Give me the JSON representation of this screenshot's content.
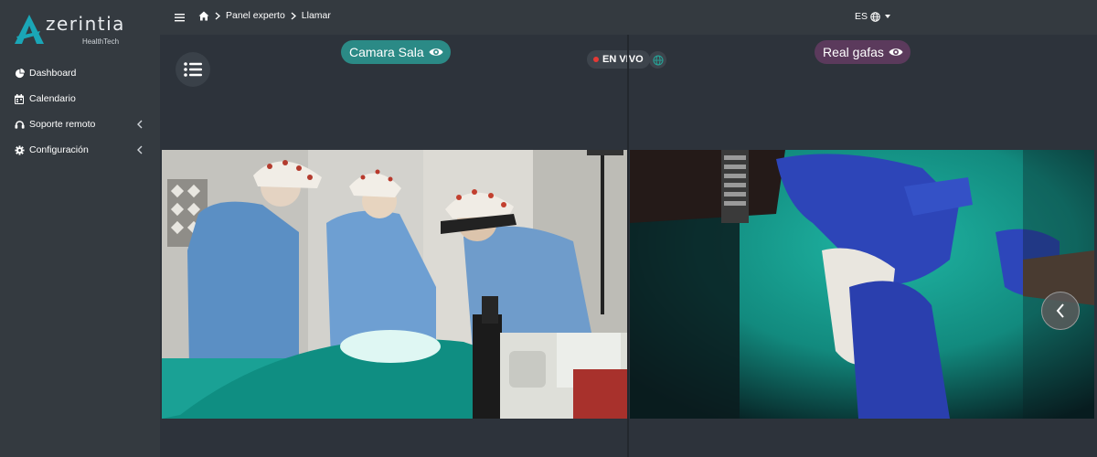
{
  "brand": {
    "name": "zerintia",
    "tagline": "HealthTech",
    "accent": "#1aa6b7"
  },
  "sidebar": {
    "items": [
      {
        "label": "Dashboard",
        "icon": "pie-chart-icon",
        "has_submenu": false
      },
      {
        "label": "Calendario",
        "icon": "calendar-icon",
        "has_submenu": false
      },
      {
        "label": "Soporte remoto",
        "icon": "headset-icon",
        "has_submenu": true
      },
      {
        "label": "Configuración",
        "icon": "gear-icon",
        "has_submenu": true
      }
    ]
  },
  "topbar": {
    "breadcrumb": [
      "Panel experto",
      "Llamar"
    ],
    "language": "ES"
  },
  "call": {
    "live_label": "EN VIVO",
    "left_stream": {
      "label": "Camara Sala",
      "color": "#2b8a86"
    },
    "right_stream": {
      "label": "Real gafas",
      "color": "#5b3a5c"
    }
  },
  "colors": {
    "live_dot": "#e53935",
    "sidebar_bg": "#343a40",
    "content_bg": "#2d333b"
  }
}
